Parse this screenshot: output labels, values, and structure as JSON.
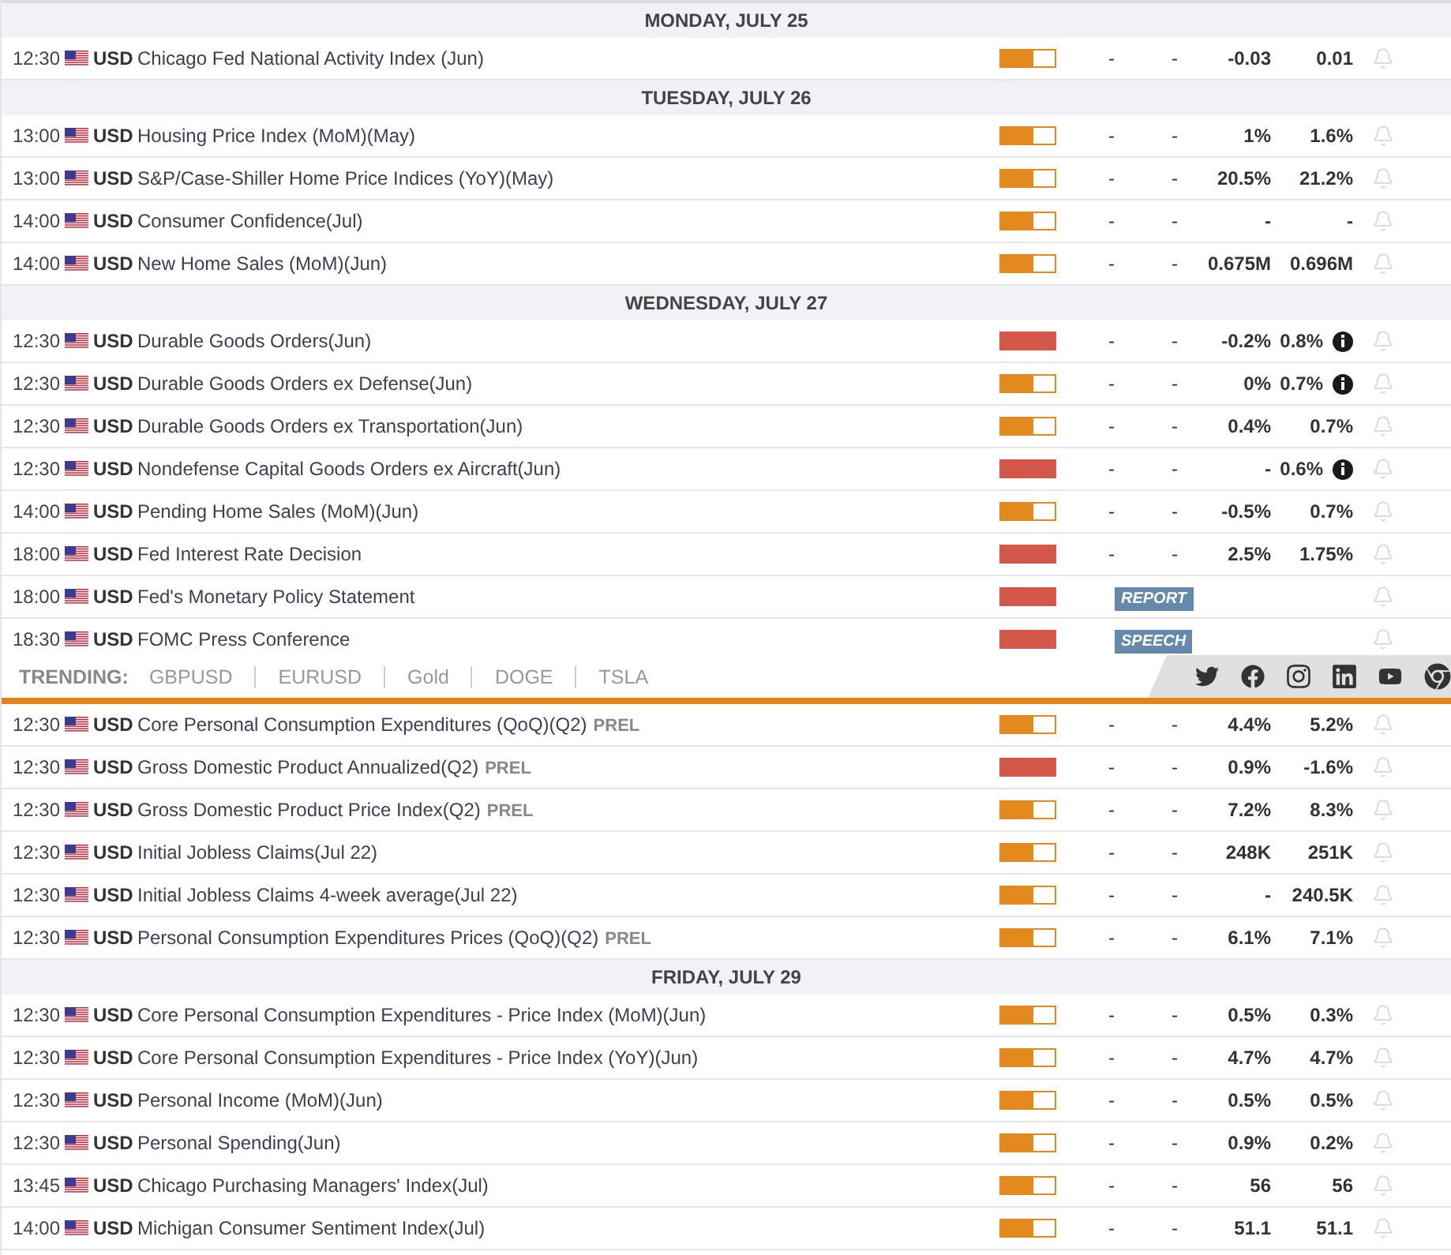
{
  "sections_above": [
    {
      "date": "MONDAY, JULY 25",
      "events": [
        {
          "time": "12:30",
          "currency": "USD",
          "name": "Chicago Fed National Activity Index (Jun)",
          "high": false,
          "values": [
            "-",
            "-",
            "-0.03",
            "0.01"
          ]
        }
      ]
    },
    {
      "date": "TUESDAY, JULY 26",
      "events": [
        {
          "time": "13:00",
          "currency": "USD",
          "name": "Housing Price Index (MoM)(May)",
          "high": false,
          "values": [
            "-",
            "-",
            "1%",
            "1.6%"
          ]
        },
        {
          "time": "13:00",
          "currency": "USD",
          "name": "S&P/Case-Shiller Home Price Indices (YoY)(May)",
          "high": false,
          "values": [
            "-",
            "-",
            "20.5%",
            "21.2%"
          ]
        },
        {
          "time": "14:00",
          "currency": "USD",
          "name": "Consumer Confidence(Jul)",
          "high": false,
          "values": [
            "-",
            "-",
            "-",
            "-"
          ]
        },
        {
          "time": "14:00",
          "currency": "USD",
          "name": "New Home Sales (MoM)(Jun)",
          "high": false,
          "values": [
            "-",
            "-",
            "0.675M",
            "0.696M"
          ]
        }
      ]
    },
    {
      "date": "WEDNESDAY, JULY 27",
      "events": [
        {
          "time": "12:30",
          "currency": "USD",
          "name": "Durable Goods Orders(Jun)",
          "high": true,
          "values": [
            "-",
            "-",
            "-0.2%",
            "0.8%"
          ],
          "info": true
        },
        {
          "time": "12:30",
          "currency": "USD",
          "name": "Durable Goods Orders ex Defense(Jun)",
          "high": false,
          "values": [
            "-",
            "-",
            "0%",
            "0.7%"
          ],
          "info": true
        },
        {
          "time": "12:30",
          "currency": "USD",
          "name": "Durable Goods Orders ex Transportation(Jun)",
          "high": false,
          "values": [
            "-",
            "-",
            "0.4%",
            "0.7%"
          ]
        },
        {
          "time": "12:30",
          "currency": "USD",
          "name": "Nondefense Capital Goods Orders ex Aircraft(Jun)",
          "high": true,
          "values": [
            "-",
            "-",
            "-",
            "0.6%"
          ],
          "info": true
        },
        {
          "time": "14:00",
          "currency": "USD",
          "name": "Pending Home Sales (MoM)(Jun)",
          "high": false,
          "values": [
            "-",
            "-",
            "-0.5%",
            "0.7%"
          ]
        },
        {
          "time": "18:00",
          "currency": "USD",
          "name": "Fed Interest Rate Decision",
          "high": true,
          "values": [
            "-",
            "-",
            "2.5%",
            "1.75%"
          ]
        },
        {
          "time": "18:00",
          "currency": "USD",
          "name": "Fed's Monetary Policy Statement",
          "high": true,
          "tag": "REPORT"
        },
        {
          "time": "18:30",
          "currency": "USD",
          "name": "FOMC Press Conference",
          "high": true,
          "tag": "SPEECH"
        }
      ]
    }
  ],
  "trending": {
    "label": "TRENDING:",
    "links": [
      "GBPUSD",
      "EURUSD",
      "Gold",
      "DOGE",
      "TSLA"
    ]
  },
  "sections_below": [
    {
      "events": [
        {
          "time": "12:30",
          "currency": "USD",
          "name": "Core Personal Consumption Expenditures (QoQ)(Q2)",
          "suffix": "PREL",
          "high": false,
          "values": [
            "-",
            "-",
            "4.4%",
            "5.2%"
          ]
        },
        {
          "time": "12:30",
          "currency": "USD",
          "name": "Gross Domestic Product Annualized(Q2)",
          "suffix": "PREL",
          "high": true,
          "values": [
            "-",
            "-",
            "0.9%",
            "-1.6%"
          ]
        },
        {
          "time": "12:30",
          "currency": "USD",
          "name": "Gross Domestic Product Price Index(Q2)",
          "suffix": "PREL",
          "high": false,
          "values": [
            "-",
            "-",
            "7.2%",
            "8.3%"
          ]
        },
        {
          "time": "12:30",
          "currency": "USD",
          "name": "Initial Jobless Claims(Jul 22)",
          "high": false,
          "values": [
            "-",
            "-",
            "248K",
            "251K"
          ]
        },
        {
          "time": "12:30",
          "currency": "USD",
          "name": "Initial Jobless Claims 4-week average(Jul 22)",
          "high": false,
          "values": [
            "-",
            "-",
            "-",
            "240.5K"
          ]
        },
        {
          "time": "12:30",
          "currency": "USD",
          "name": "Personal Consumption Expenditures Prices (QoQ)(Q2)",
          "suffix": "PREL",
          "high": false,
          "values": [
            "-",
            "-",
            "6.1%",
            "7.1%"
          ]
        }
      ]
    },
    {
      "date": "FRIDAY, JULY 29",
      "events": [
        {
          "time": "12:30",
          "currency": "USD",
          "name": "Core Personal Consumption Expenditures - Price Index (MoM)(Jun)",
          "high": false,
          "values": [
            "-",
            "-",
            "0.5%",
            "0.3%"
          ]
        },
        {
          "time": "12:30",
          "currency": "USD",
          "name": "Core Personal Consumption Expenditures - Price Index (YoY)(Jun)",
          "high": false,
          "values": [
            "-",
            "-",
            "4.7%",
            "4.7%"
          ]
        },
        {
          "time": "12:30",
          "currency": "USD",
          "name": "Personal Income (MoM)(Jun)",
          "high": false,
          "values": [
            "-",
            "-",
            "0.5%",
            "0.5%"
          ]
        },
        {
          "time": "12:30",
          "currency": "USD",
          "name": "Personal Spending(Jun)",
          "high": false,
          "values": [
            "-",
            "-",
            "0.9%",
            "0.2%"
          ]
        },
        {
          "time": "13:45",
          "currency": "USD",
          "name": "Chicago Purchasing Managers' Index(Jul)",
          "high": false,
          "values": [
            "-",
            "-",
            "56",
            "56"
          ]
        },
        {
          "time": "14:00",
          "currency": "USD",
          "name": "Michigan Consumer Sentiment Index(Jul)",
          "high": false,
          "values": [
            "-",
            "-",
            "51.1",
            "51.1"
          ]
        }
      ]
    }
  ]
}
